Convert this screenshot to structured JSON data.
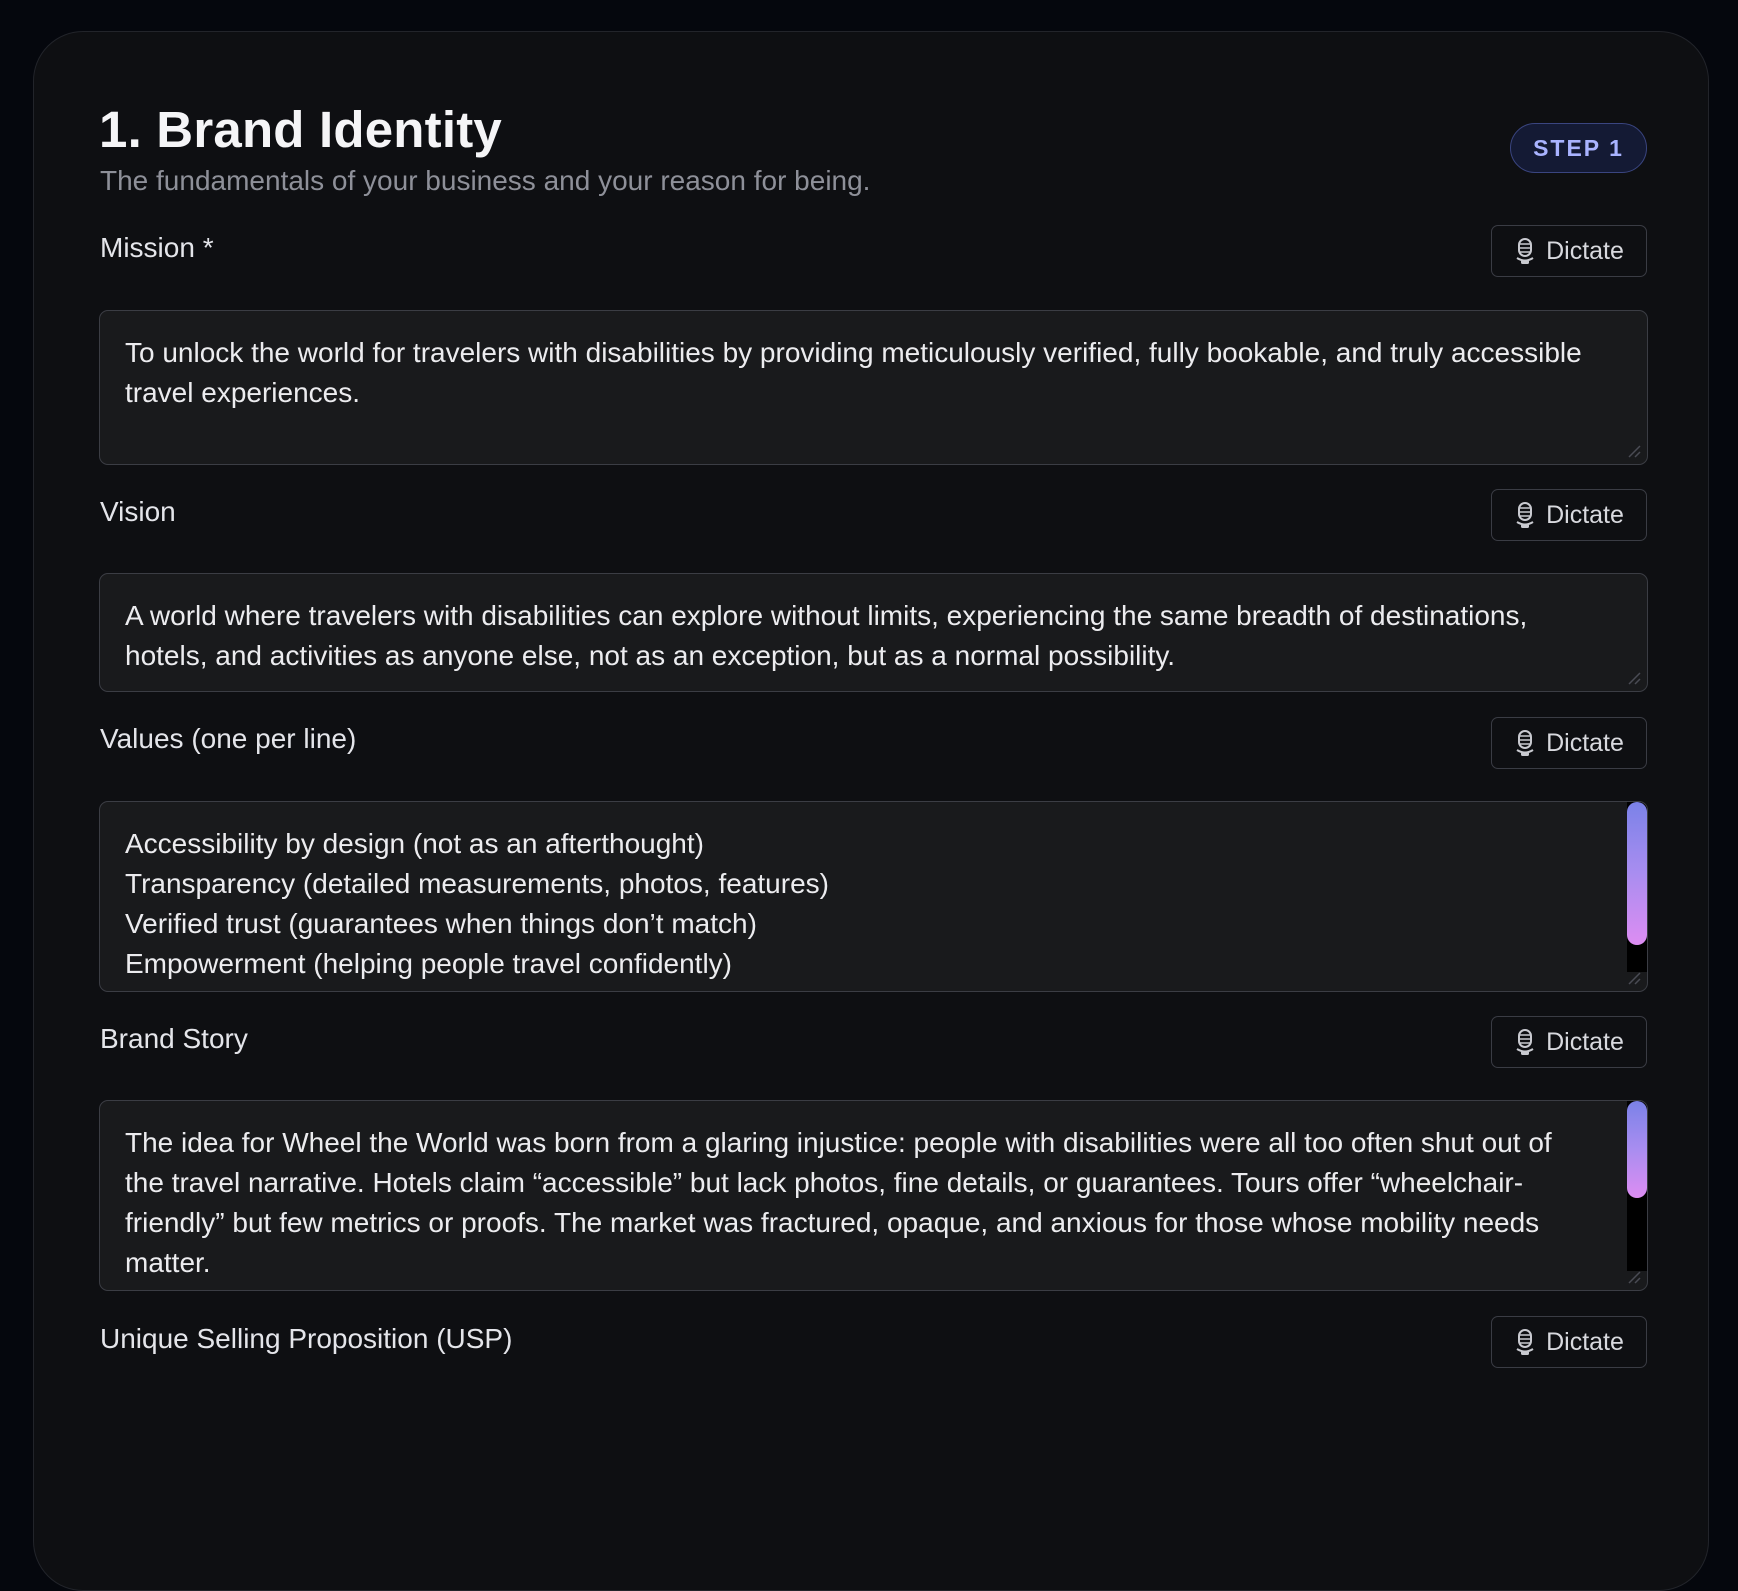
{
  "section": {
    "title": "1. Brand Identity",
    "subtitle": "The fundamentals of your business and your reason for being.",
    "step_badge": "STEP 1"
  },
  "dictate_label": "Dictate",
  "icons": {
    "dictate": "microphone-icon"
  },
  "colors": {
    "page_background": "#05070d",
    "card_background": "#0e0f12",
    "field_background": "#191a1c",
    "badge_text": "#a9b3ff",
    "scrollbar_gradient_start": "#7b82e8",
    "scrollbar_gradient_end": "#dd8df2"
  },
  "fields": {
    "mission": {
      "label": "Mission *",
      "value": "To unlock the world for travelers with disabilities by providing meticulously verified, fully bookable, and truly accessible travel experiences."
    },
    "vision": {
      "label": "Vision",
      "value": "A world where travelers with disabilities can explore without limits, experiencing the same breadth of destinations, hotels, and activities as anyone else, not as an exception, but as a normal possibility."
    },
    "values": {
      "label": "Values (one per line)",
      "value": "Accessibility by design (not as an afterthought)\nTransparency (detailed measurements, photos, features)\nVerified trust (guarantees when things don’t match)\nEmpowerment (helping people travel confidently)\nInnovation in mapping and accessibility tech"
    },
    "brand_story": {
      "label": "Brand Story",
      "value": "The idea for Wheel the World was born from a glaring injustice: people with disabilities were all too often shut out of the travel narrative. Hotels claim “accessible” but lack photos, fine details, or guarantees. Tours offer “wheelchair-friendly” but few metrics or proofs. The market was fractured, opaque, and anxious for those whose mobility needs matter.\nOne founder is a wheelchair user, carrying firsthand insight about the pain points of planning travel under"
    },
    "usp": {
      "label": "Unique Selling Proposition (USP)"
    }
  }
}
